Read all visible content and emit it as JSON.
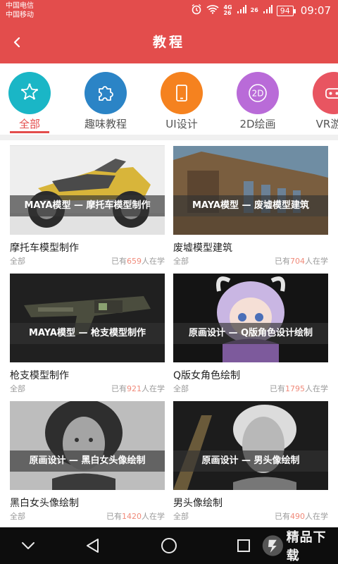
{
  "status_bar": {
    "carrier_1": "中国电信",
    "carrier_2": "中国移动",
    "net_a": "4G",
    "net_b": "26",
    "net_c": "26",
    "battery": "94",
    "time": "09:07",
    "icons": [
      "alarm-icon",
      "wifi-icon",
      "signal-icon",
      "signal-icon",
      "battery-icon"
    ]
  },
  "header": {
    "back_icon": "chevron-left-icon",
    "title": "教程",
    "background": "#e34d4c"
  },
  "categories": [
    {
      "label": "全部",
      "icon": "sheriff-star-icon",
      "color": "#1ab6c6",
      "active": true
    },
    {
      "label": "趣味教程",
      "icon": "puzzle-icon",
      "color": "#2b84c6",
      "active": false
    },
    {
      "label": "UI设计",
      "icon": "tablet-icon",
      "color": "#f5821f",
      "active": false
    },
    {
      "label": "2D绘画",
      "icon": "2d-icon",
      "color": "#b96bd8",
      "active": false,
      "icon_text": "2D"
    },
    {
      "label": "VR游戏",
      "icon": "vr-headset-icon",
      "color": "#e85561",
      "active": false
    }
  ],
  "courses": [
    {
      "banner": "MAYA模型 — 摩托车模型制作",
      "title": "摩托车模型制作",
      "category": "全部",
      "count_prefix": "已有",
      "count": "659",
      "count_suffix": "人在学"
    },
    {
      "banner": "MAYA模型 — 废墟模型建筑",
      "title": "废墟模型建筑",
      "category": "全部",
      "count_prefix": "已有",
      "count": "704",
      "count_suffix": "人在学"
    },
    {
      "banner": "MAYA模型 — 枪支模型制作",
      "title": "枪支模型制作",
      "category": "全部",
      "count_prefix": "已有",
      "count": "921",
      "count_suffix": "人在学"
    },
    {
      "banner": "原画设计 — Q版角色设计绘制",
      "title": "Q版女角色绘制",
      "category": "全部",
      "count_prefix": "已有",
      "count": "1795",
      "count_suffix": "人在学"
    },
    {
      "banner": "原画设计 — 黑白女头像绘制",
      "title": "黑白女头像绘制",
      "category": "全部",
      "count_prefix": "已有",
      "count": "1420",
      "count_suffix": "人在学"
    },
    {
      "banner": "原画设计 — 男头像绘制",
      "title": "男头像绘制",
      "category": "全部",
      "count_prefix": "已有",
      "count": "490",
      "count_suffix": "人在学"
    }
  ],
  "nav_bar": {
    "icons": [
      "nav-collapse-icon",
      "nav-back-icon",
      "nav-home-icon",
      "nav-recents-icon"
    ],
    "watermark": "精品下载"
  },
  "colors": {
    "accent": "#e34d4c",
    "count_highlight": "#f08a7a",
    "muted_text": "#9a9a9a"
  }
}
